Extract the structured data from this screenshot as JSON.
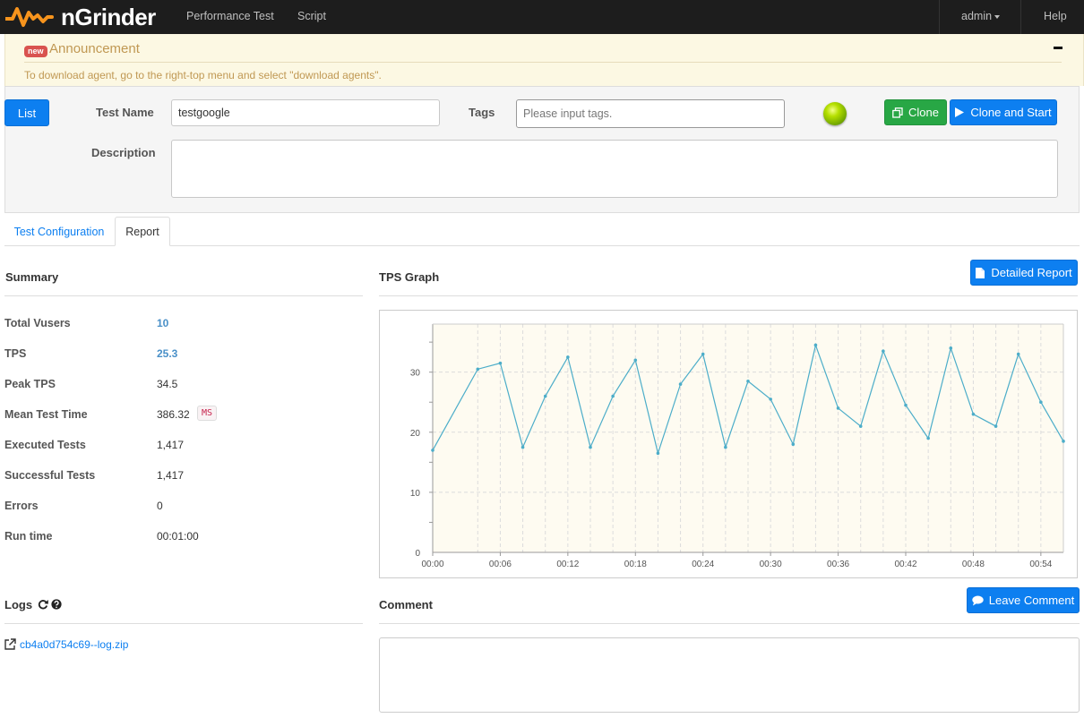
{
  "navbar": {
    "brand": "nGrinder",
    "menu": [
      "Performance Test",
      "Script"
    ],
    "user": "admin",
    "help": "Help"
  },
  "announcement": {
    "badge": "new",
    "title": "Announcement",
    "text": "To download agent, go to the right-top menu and select \"download agents\"."
  },
  "form": {
    "list_button": "List",
    "test_name_label": "Test Name",
    "test_name_value": "testgoogle",
    "tags_label": "Tags",
    "tags_placeholder": "Please input tags.",
    "description_label": "Description",
    "description_value": "",
    "clone_button": "Clone",
    "clone_start_button": "Clone and Start"
  },
  "tabs": [
    "Test Configuration",
    "Report"
  ],
  "summary": {
    "title": "Summary",
    "rows": [
      {
        "label": "Total Vusers",
        "value": "10"
      },
      {
        "label": "TPS",
        "value": "25.3"
      },
      {
        "label": "Peak TPS",
        "value": "34.5"
      },
      {
        "label": "Mean Test Time",
        "value": "386.32"
      },
      {
        "label": "Executed Tests",
        "value": "1,417"
      },
      {
        "label": "Successful Tests",
        "value": "1,417"
      },
      {
        "label": "Errors",
        "value": "0"
      },
      {
        "label": "Run time",
        "value": "00:01:00"
      }
    ],
    "mean_unit": "MS"
  },
  "tps_graph": {
    "title": "TPS Graph",
    "detailed_report_button": "Detailed Report"
  },
  "chart_data": {
    "type": "line",
    "title": "",
    "xlabel": "",
    "ylabel": "",
    "x": [
      "00:00",
      "00:04",
      "00:06",
      "00:08",
      "00:10",
      "00:12",
      "00:14",
      "00:16",
      "00:18",
      "00:20",
      "00:22",
      "00:24",
      "00:26",
      "00:28",
      "00:30",
      "00:32",
      "00:34",
      "00:36",
      "00:38",
      "00:40",
      "00:42",
      "00:44",
      "00:46",
      "00:48",
      "00:50",
      "00:52",
      "00:54",
      "00:56"
    ],
    "series": [
      {
        "values": [
          17,
          30.5,
          31.5,
          17.5,
          26,
          32.5,
          17.5,
          26,
          32,
          16.5,
          28,
          33,
          17.5,
          28.5,
          25.5,
          18,
          34.5,
          24,
          21,
          33.5,
          24.5,
          19,
          34,
          23,
          21,
          33,
          25,
          18.5
        ]
      }
    ],
    "x_tick_labels": [
      "00:00",
      "00:06",
      "00:12",
      "00:18",
      "00:24",
      "00:30",
      "00:36",
      "00:42",
      "00:48",
      "00:54"
    ],
    "y_tick_labels": [
      "0",
      "10",
      "20",
      "30"
    ],
    "ylim": [
      0,
      38
    ],
    "grid": true,
    "line_color": "#4cadc9",
    "plot_background": "#fefbf1"
  },
  "logs": {
    "title": "Logs",
    "file": "cb4a0d754c69--log.zip"
  },
  "comment": {
    "title": "Comment",
    "button": "Leave Comment",
    "value": ""
  },
  "colors": {
    "primary": "#0d7ff0",
    "success": "#28a745",
    "navbar": "#1d1d1d",
    "announcement_bg": "#fcf8e3",
    "brand_orange": "#f7941d"
  }
}
